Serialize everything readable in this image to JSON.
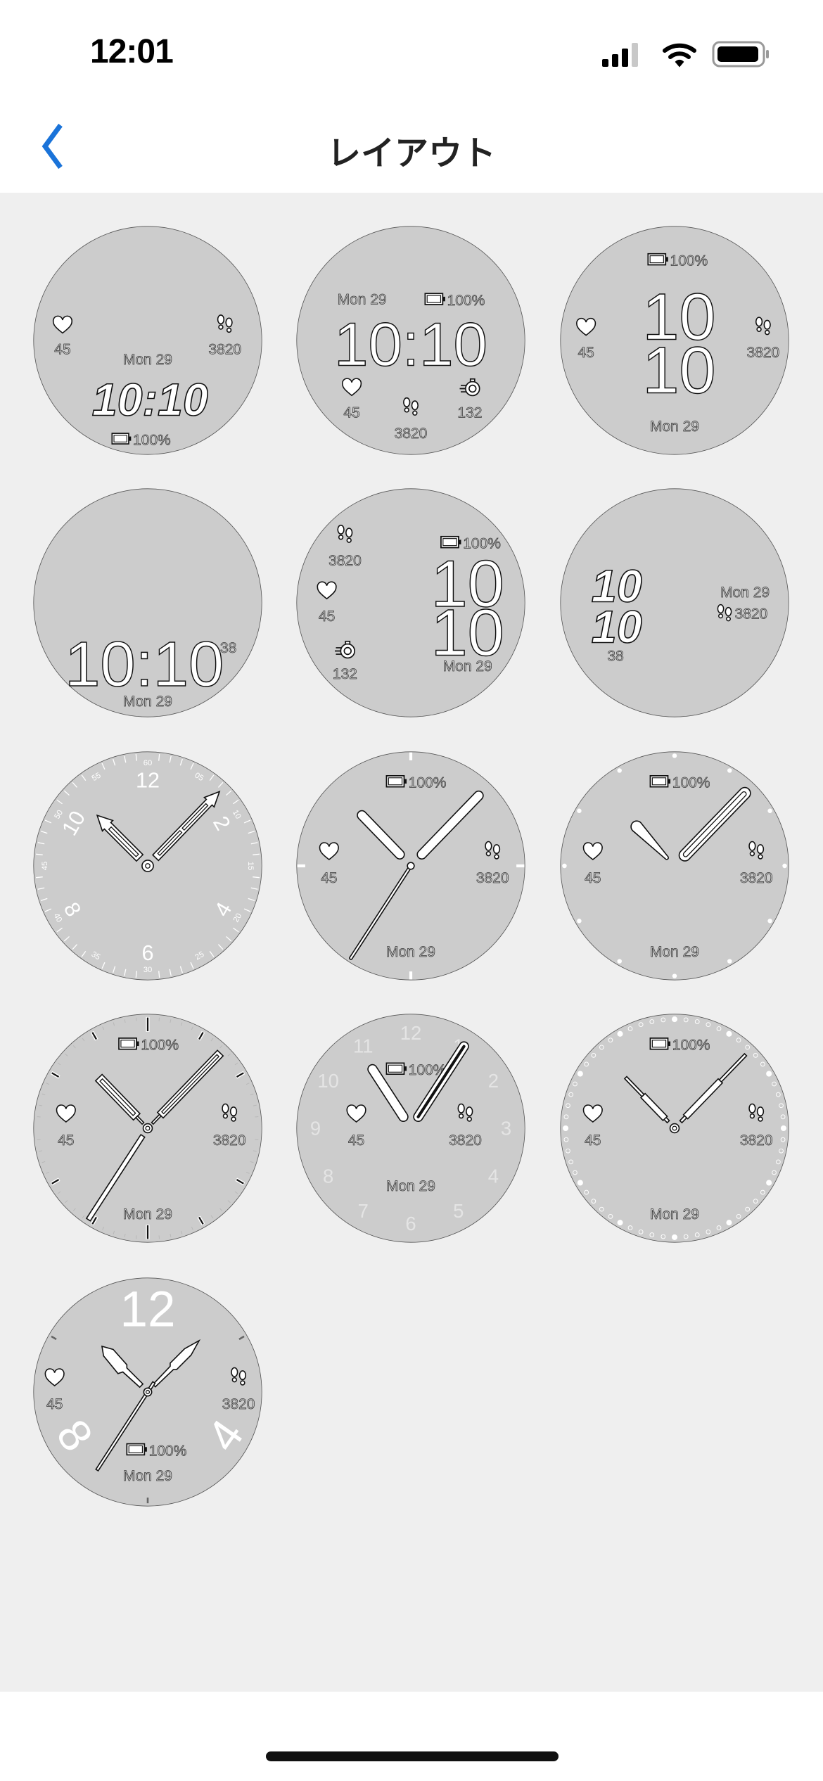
{
  "status_bar": {
    "time": "12:01",
    "icons": [
      "cellular-signal-icon",
      "wifi-icon",
      "battery-icon"
    ]
  },
  "nav": {
    "title": "レイアウト",
    "back_icon": "chevron-left-icon",
    "accent_color": "#1a73d9"
  },
  "colors": {
    "face_fill": "#cccccc",
    "page_bg": "#efefef"
  },
  "faces": [
    {
      "date": "Mon 29",
      "time": "10:10",
      "battery": "100%",
      "heart_rate": "45",
      "steps": "3820"
    },
    {
      "date": "Mon 29",
      "time": "10:10",
      "battery": "100%",
      "heart_rate": "45",
      "steps": "3820",
      "calories": "132"
    },
    {
      "date": "Mon 29",
      "hours": "10",
      "minutes": "10",
      "battery": "100%",
      "heart_rate": "45",
      "steps": "3820"
    },
    {
      "date": "Mon 29",
      "time": "10:10",
      "seconds": "38"
    },
    {
      "date": "Mon 29",
      "hours": "10",
      "minutes": "10",
      "battery": "100%",
      "heart_rate": "45",
      "steps": "3820",
      "calories": "132"
    },
    {
      "date": "Mon 29",
      "hours": "10",
      "minutes": "10",
      "seconds": "38",
      "steps": "3820"
    },
    {
      "hour_numerals": [
        "12",
        "2",
        "4",
        "6",
        "8",
        "10"
      ],
      "minute_numerals": [
        "60",
        "05",
        "10",
        "15",
        "20",
        "25",
        "30",
        "35",
        "40",
        "45",
        "50",
        "55"
      ]
    },
    {
      "date": "Mon 29",
      "battery": "100%",
      "heart_rate": "45",
      "steps": "3820"
    },
    {
      "date": "Mon 29",
      "battery": "100%",
      "heart_rate": "45",
      "steps": "3820"
    },
    {
      "date": "Mon 29",
      "battery": "100%",
      "heart_rate": "45",
      "steps": "3820"
    },
    {
      "date": "Mon 29",
      "battery": "100%",
      "heart_rate": "45",
      "steps": "3820",
      "hour_numerals": [
        "12",
        "1",
        "2",
        "3",
        "4",
        "5",
        "6",
        "7",
        "8",
        "9",
        "10",
        "11"
      ]
    },
    {
      "date": "Mon 29",
      "battery": "100%",
      "heart_rate": "45",
      "steps": "3820"
    },
    {
      "date": "Mon 29",
      "battery": "100%",
      "heart_rate": "45",
      "steps": "3820",
      "hour_numerals": [
        "12",
        "4",
        "8"
      ]
    }
  ]
}
